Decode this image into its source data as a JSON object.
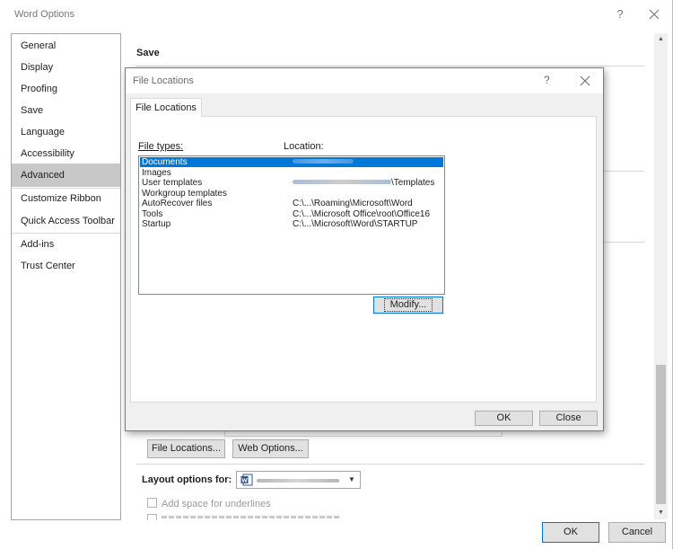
{
  "outer": {
    "title": "Word Options",
    "help_glyph": "?",
    "ok_label": "OK",
    "cancel_label": "Cancel"
  },
  "nav": {
    "items": [
      {
        "label": "General"
      },
      {
        "label": "Display"
      },
      {
        "label": "Proofing"
      },
      {
        "label": "Save"
      },
      {
        "label": "Language"
      },
      {
        "label": "Accessibility"
      },
      {
        "label": "Advanced"
      },
      {
        "label": "Customize Ribbon"
      },
      {
        "label": "Quick Access Toolbar"
      },
      {
        "label": "Add-ins"
      },
      {
        "label": "Trust Center"
      }
    ],
    "selected": "Advanced"
  },
  "content": {
    "save_heading": "Save",
    "file_locations_button": "File Locations...",
    "web_options_button": "Web Options...",
    "layout_options_label": "Layout options for:",
    "add_space_checkbox": "Add space for underlines"
  },
  "dialog": {
    "title": "File Locations",
    "help_glyph": "?",
    "tab_label": "File Locations",
    "file_types_label": "File types:",
    "location_label": "Location:",
    "rows": [
      {
        "type": "Documents",
        "location": ""
      },
      {
        "type": "Images",
        "location": ""
      },
      {
        "type": "User templates",
        "location": "\\Templates"
      },
      {
        "type": "Workgroup templates",
        "location": ""
      },
      {
        "type": "AutoRecover files",
        "location": "C:\\...\\Roaming\\Microsoft\\Word"
      },
      {
        "type": "Tools",
        "location": "C:\\...\\Microsoft Office\\root\\Office16"
      },
      {
        "type": "Startup",
        "location": "C:\\...\\Microsoft\\Word\\STARTUP"
      }
    ],
    "selected_row": "Documents",
    "modify_button": "Modify...",
    "ok_label": "OK",
    "close_label": "Close"
  },
  "colors": {
    "selection": "#0078d7",
    "nav_selected": "#c8c8c8"
  }
}
